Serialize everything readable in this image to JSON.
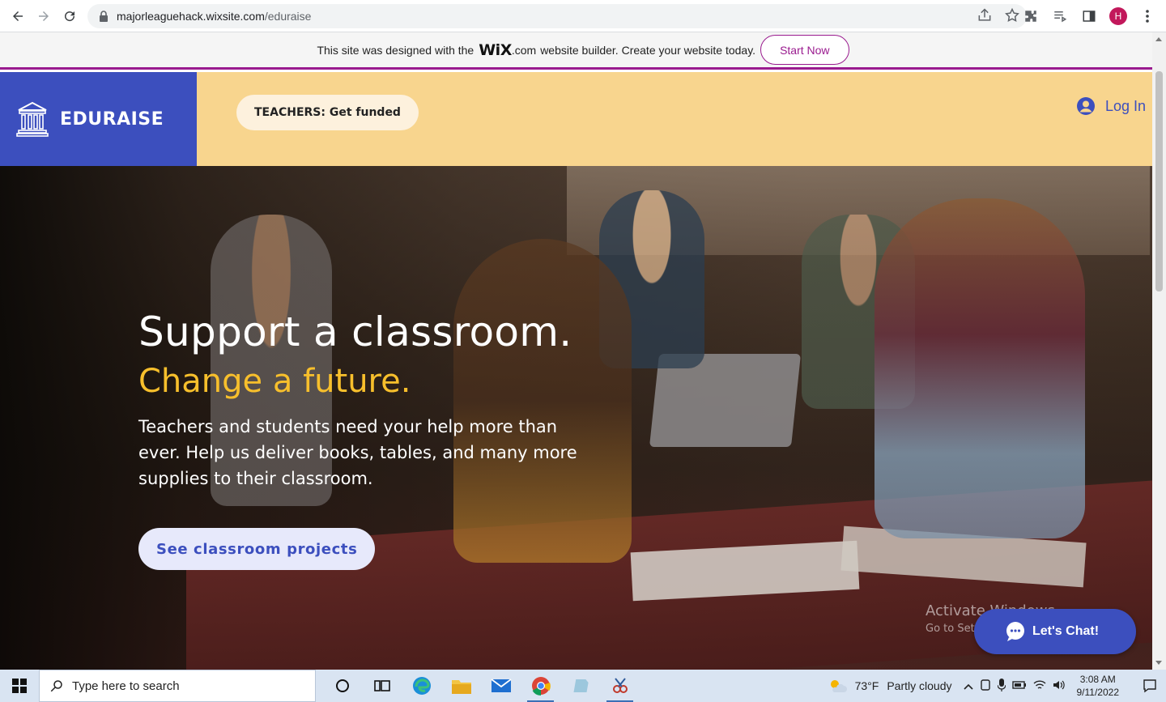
{
  "browser": {
    "url_host": "majorleaguehack.wixsite.com",
    "url_path": "/eduraise",
    "profile_initial": "H"
  },
  "wix_banner": {
    "message_before": "This site was designed with the",
    "logo": "WiX",
    "dotcom": ".com",
    "message_after": "website builder. Create your website today.",
    "button": "Start Now"
  },
  "site": {
    "brand": "EDURAISE",
    "nav_button": "TEACHERS: Get funded",
    "login": "Log In"
  },
  "hero": {
    "title": "Support a classroom.",
    "subtitle": "Change a future.",
    "body": "Teachers and students need your help more than ever. Help us deliver books, tables, and many more supplies to their classroom.",
    "cta": "See classroom projects"
  },
  "overlay": {
    "activate_title": "Activate Windows",
    "activate_sub": "Go to Settings to activate Windows.",
    "chat_button": "Let's Chat!"
  },
  "taskbar": {
    "search_placeholder": "Type here to search",
    "weather_temp": "73°F",
    "weather_desc": "Partly cloudy",
    "time": "3:08 AM",
    "date": "9/11/2022"
  },
  "colors": {
    "brand_blue": "#3c4fbe",
    "header_yellow": "#f8d58e",
    "accent_gold": "#f7bf2c",
    "wix_purple": "#9a1b8f"
  }
}
